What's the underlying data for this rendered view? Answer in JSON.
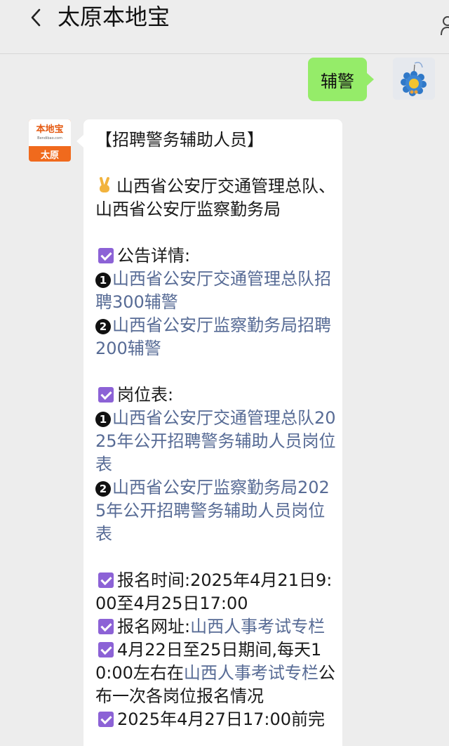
{
  "header": {
    "title": "太原本地宝",
    "back_icon": "chevron-left-icon",
    "profile_icon": "person-icon"
  },
  "outgoing": {
    "text": "辅警"
  },
  "sender": {
    "logo_text": "本地宝",
    "logo_url": "Bendibao.com",
    "logo_city": "太原"
  },
  "message": {
    "title": "【招聘警务辅助人员】",
    "orgs": "山西省公安厅交通管理总队、山西省公安厅监察勤务局",
    "announce_label": "公告详情:",
    "announce_num1": "❶",
    "announce_link1": "山西省公安厅交通管理总队招聘300辅警",
    "announce_num2": "❷",
    "announce_link2": "山西省公安厅监察勤务局招聘200辅警",
    "positions_label": "岗位表:",
    "positions_num1": "❶",
    "positions_link1": "山西省公安厅交通管理总队2025年公开招聘警务辅助人员岗位表",
    "positions_num2": "❷",
    "positions_link2": "山西省公安厅监察勤务局2025年公开招聘警务辅助人员岗位表",
    "reg_time": "报名时间:2025年4月21日9:00至4月25日17:00",
    "reg_site_label": "报名网址:",
    "reg_site_link": "山西人事考试专栏",
    "daily_prefix": "4月22日至25日期间,每天10:00左右在",
    "daily_link": "山西人事考试专栏",
    "daily_suffix": "公布一次各岗位报名情况",
    "next_item": "2025年4月27日17:00前完"
  },
  "colors": {
    "background": "#ededed",
    "bubble_out": "#95ec69",
    "bubble_in": "#ffffff",
    "link": "#576b95",
    "checkbox": "#8c62d6",
    "logo_orange": "#f06a1d"
  }
}
